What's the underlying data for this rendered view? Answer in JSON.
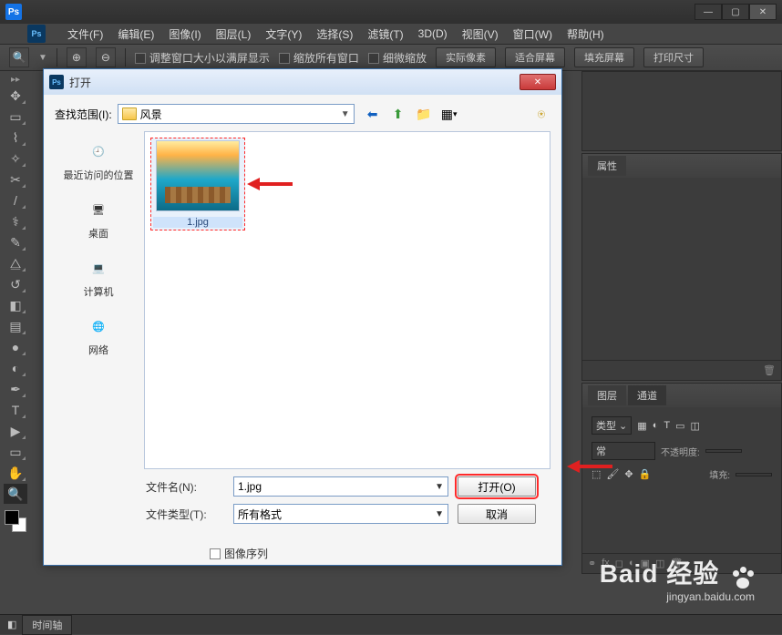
{
  "menu": {
    "file": "文件(F)",
    "edit": "编辑(E)",
    "image": "图像(I)",
    "layer": "图层(L)",
    "text": "文字(Y)",
    "select": "选择(S)",
    "filter": "滤镜(T)",
    "threeD": "3D(D)",
    "view": "视图(V)",
    "window": "窗口(W)",
    "help": "帮助(H)"
  },
  "options": {
    "fit": "调整窗口大小以满屏显示",
    "zoomAll": "缩放所有窗口",
    "scrubby": "细微缩放",
    "actualPx": "实际像素",
    "fitScreen": "适合屏幕",
    "fillScreen": "填充屏幕",
    "printSize": "打印尺寸"
  },
  "dialog": {
    "title": "打开",
    "lookInLabel": "查找范围(I):",
    "lookInValue": "风景",
    "places": {
      "recent": "最近访问的位置",
      "desktop": "桌面",
      "computer": "计算机",
      "network": "网络"
    },
    "file1": "1.jpg",
    "fileNameLabel": "文件名(N):",
    "fileNameValue": "1.jpg",
    "fileTypeLabel": "文件类型(T):",
    "fileTypeValue": "所有格式",
    "openBtn": "打开(O)",
    "cancelBtn": "取消",
    "imageSeq": "图像序列"
  },
  "panels": {
    "properties": "属性",
    "layers": "图层",
    "channels": "通道",
    "kindLabel": "类型",
    "modeNormal": "常",
    "opacityLabel": "不透明度:",
    "fillLabel": "填充:"
  },
  "status": {
    "timeline": "时间轴"
  },
  "watermark": {
    "brand": "Baid 经验",
    "url": "jingyan.baidu.com"
  }
}
